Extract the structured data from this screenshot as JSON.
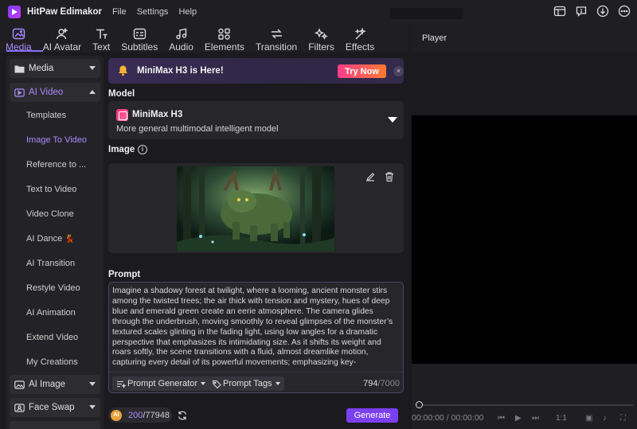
{
  "app": {
    "title": "HitPaw Edimakor",
    "menu": [
      "File",
      "Settings",
      "Help"
    ],
    "window_icons": [
      "layout-icon",
      "feedback-icon",
      "download-icon",
      "more-icon"
    ]
  },
  "toolbar": {
    "tabs": [
      {
        "label": "Media",
        "icon": "media-icon",
        "active": true
      },
      {
        "label": "AI Avatar",
        "icon": "avatar-icon",
        "active": false
      },
      {
        "label": "Text",
        "icon": "text-icon",
        "active": false
      },
      {
        "label": "Subtitles",
        "icon": "subtitles-icon",
        "active": false
      },
      {
        "label": "Audio",
        "icon": "audio-icon",
        "active": false
      },
      {
        "label": "Elements",
        "icon": "elements-icon",
        "active": false
      },
      {
        "label": "Transition",
        "icon": "transition-icon",
        "active": false
      },
      {
        "label": "Filters",
        "icon": "filters-icon",
        "active": false
      },
      {
        "label": "Effects",
        "icon": "effects-icon",
        "active": false
      }
    ]
  },
  "sidebar": {
    "media": "Media",
    "ai_video": "AI Video",
    "sub_items": [
      "Templates",
      "Image To Video",
      "Reference to ...",
      "Text to Video",
      "Video Clone",
      "AI Dance",
      "AI Transition",
      "Restyle Video",
      "AI Animation",
      "Extend Video",
      "My Creations"
    ],
    "active_sub": "Image To Video",
    "ai_image": "AI Image",
    "face_swap": "Face Swap"
  },
  "banner": {
    "text": "MiniMax H3 is Here!",
    "button": "Try Now",
    "close": "×"
  },
  "model": {
    "section_label": "Model",
    "name": "MiniMax H3",
    "description": "More general multimodal intelligent model"
  },
  "image": {
    "section_label": "Image",
    "info": "i"
  },
  "prompt": {
    "section_label": "Prompt",
    "text": "Imagine a shadowy forest at twilight, where a looming, ancient monster stirs among the twisted trees; the air thick with tension and mystery, hues of deep blue and emerald green create an eerie atmosphere. The camera glides through the underbrush, moving smoothly to reveal glimpses of the monster’s textured scales glinting in the fading light, using low angles for a dramatic perspective that emphasizes its intimidating size. As it shifts its weight and roars softly, the scene transitions with a fluid, almost dreamlike motion, capturing every detail of its powerful movements; emphasizing key-",
    "generator_label": "Prompt Generator",
    "tags_label": "Prompt Tags",
    "count_current": "794",
    "count_max": "/7000"
  },
  "footer": {
    "coin_label": "AI",
    "credits_used": "200",
    "credits_total": "/77948",
    "generate": "Generate"
  },
  "player": {
    "title": "Player",
    "time": "00:00:00 / 00:00:00",
    "speed": "1:1"
  },
  "colors": {
    "accent": "#a98bff",
    "generate": "#7b3ff2",
    "try_now_start": "#ff3d8b",
    "try_now_end": "#ff7a2e"
  }
}
